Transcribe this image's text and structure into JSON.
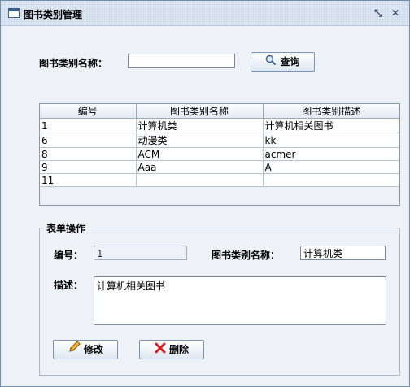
{
  "window": {
    "title": "图书类别管理",
    "restore_glyph": "⤡",
    "close_glyph": "✕"
  },
  "search": {
    "label": "图书类别名称：",
    "value": "",
    "button_label": "查询"
  },
  "table": {
    "headers": [
      "编号",
      "图书类别名称",
      "图书类别描述"
    ],
    "rows": [
      [
        "1",
        "计算机类",
        "计算机相关图书"
      ],
      [
        "6",
        "动漫类",
        "kk"
      ],
      [
        "8",
        "ACM",
        "acmer"
      ],
      [
        "9",
        "Aaa",
        "A"
      ],
      [
        "11",
        "",
        ""
      ]
    ]
  },
  "form": {
    "group_title": "表单操作",
    "id_label": "编号：",
    "id_value": "1",
    "name_label": "图书类别名称：",
    "name_value": "计算机类",
    "desc_label": "描述：",
    "desc_value": "计算机相关图书",
    "modify_label": "修改",
    "delete_label": "删除"
  },
  "colors": {
    "delete_icon": "#d61d1d",
    "edit_icon": "#e0a020"
  }
}
